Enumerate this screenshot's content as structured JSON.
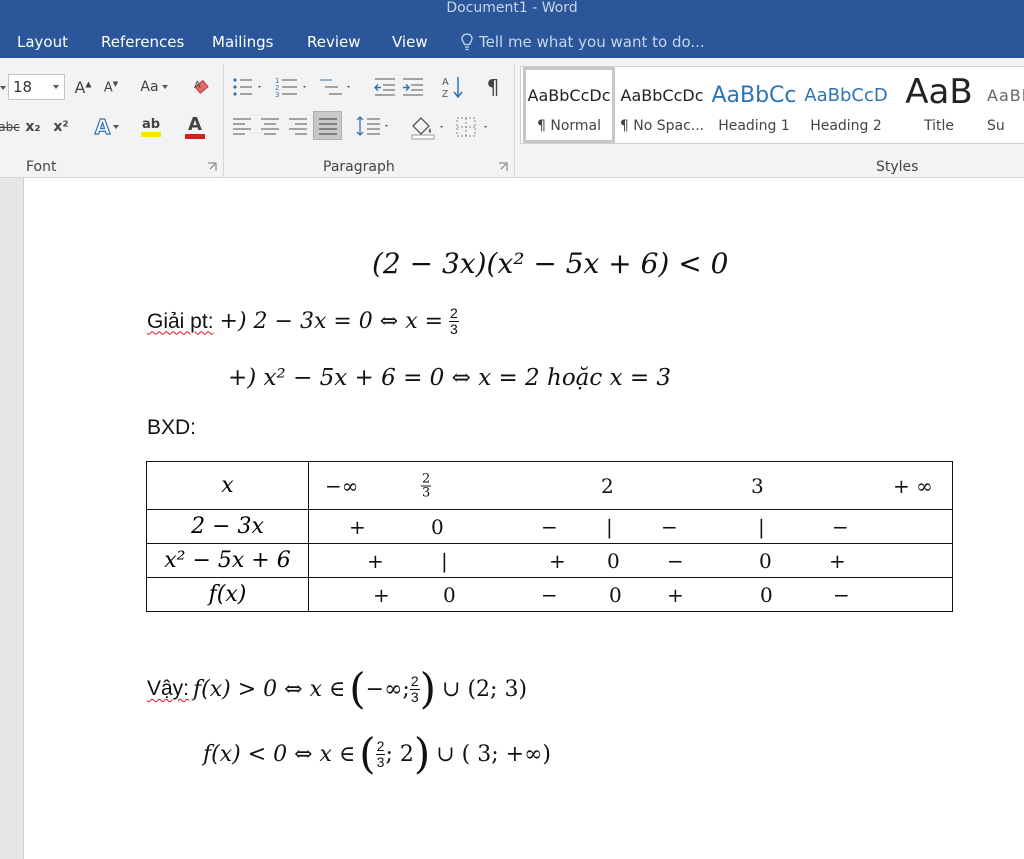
{
  "window": {
    "title": "Document1 - Word"
  },
  "tabs": [
    "Layout",
    "References",
    "Mailings",
    "Review",
    "View"
  ],
  "tell_me": {
    "placeholder": "Tell me what you want to do..."
  },
  "ribbon": {
    "font": {
      "label": "Font",
      "size": "18",
      "grow_icon": "font-grow-icon",
      "change_case_label": "Aa",
      "subscript_label": "x₂",
      "superscript_label": "x²",
      "strike_label": "abc",
      "highlight_label": "ab",
      "font_color_label": "A"
    },
    "paragraph": {
      "label": "Paragraph",
      "show_marks": "¶"
    },
    "styles": {
      "label": "Styles",
      "items": [
        {
          "preview": "AaBbCcDc",
          "name": "¶ Normal"
        },
        {
          "preview": "AaBbCcDc",
          "name": "¶ No Spac..."
        },
        {
          "preview": "AaBbCc",
          "name": "Heading 1"
        },
        {
          "preview": "AaBbCcD",
          "name": "Heading 2"
        },
        {
          "preview": "AaB",
          "name": "Title"
        },
        {
          "preview": "AaBl",
          "name": "Su"
        }
      ]
    },
    "colors": {
      "highlight": "#f6e600",
      "font_color": "#d21f1f",
      "heading": "#2e74b5"
    }
  },
  "document": {
    "inequality": "(2 − 3x)(x² − 5x + 6) < 0",
    "solve_label": "Giải pt:",
    "solve_line1": "+) 2 − 3x = 0 ⇔ x =",
    "frac_num": "2",
    "frac_den": "3",
    "solve_line2": "+) x² − 5x + 6 = 0  ⇔ x = 2 hoặc x = 3",
    "bxd_label": "BXD:",
    "table": {
      "rows": [
        {
          "head": "x",
          "marks": [
            "−∞",
            "2",
            "3",
            "+ ∞"
          ]
        },
        {
          "head": "2 − 3x",
          "marks": [
            "+",
            "0",
            "−",
            "|",
            "−",
            "|",
            "−"
          ]
        },
        {
          "head": "x² − 5x + 6",
          "marks": [
            "+",
            "|",
            "+",
            "0",
            "−",
            "0",
            "+"
          ]
        },
        {
          "head": "f(x)",
          "marks": [
            "+",
            "0",
            "−",
            "0",
            "+",
            "0",
            "−"
          ]
        }
      ]
    },
    "conclusion_label": "Vậy:",
    "conclusion1_lhs": "f(x) > 0 ⇔ x  ∈",
    "conclusion1_interval_a": "−∞;",
    "conclusion1_interval_b": " ∪ (2; 3)",
    "conclusion2_lhs": "f(x) < 0 ⇔ x  ∈",
    "conclusion2_interval_a": "; 2",
    "conclusion2_interval_b": " ∪ ( 3; +∞)"
  }
}
